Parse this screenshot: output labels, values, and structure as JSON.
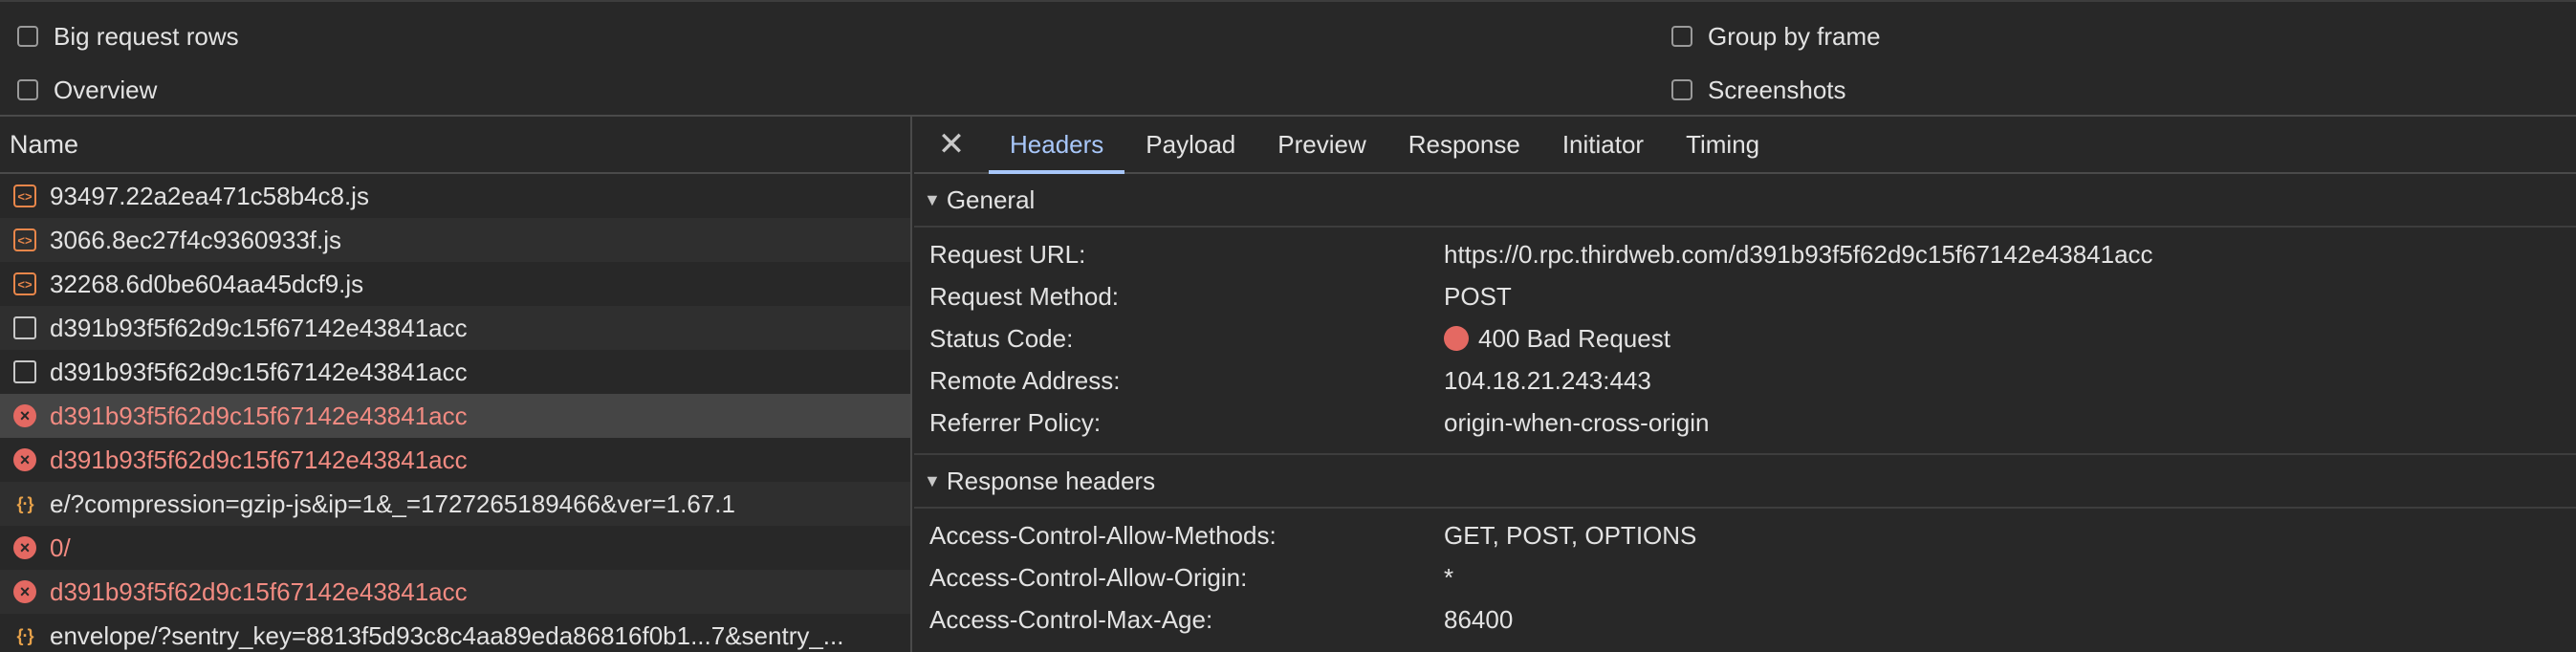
{
  "options": {
    "big_request_rows": "Big request rows",
    "overview": "Overview",
    "group_by_frame": "Group by frame",
    "screenshots": "Screenshots"
  },
  "list": {
    "header": "Name",
    "rows": [
      {
        "name": "93497.22a2ea471c58b4c8.js",
        "type": "script-icon"
      },
      {
        "name": "3066.8ec27f4c9360933f.js",
        "type": "script-icon"
      },
      {
        "name": "32268.6d0be604aa45dcf9.js",
        "type": "script-icon"
      },
      {
        "name": "d391b93f5f62d9c15f67142e43841acc",
        "type": "document-icon"
      },
      {
        "name": "d391b93f5f62d9c15f67142e43841acc",
        "type": "document-icon"
      },
      {
        "name": "d391b93f5f62d9c15f67142e43841acc",
        "type": "error-icon"
      },
      {
        "name": "d391b93f5f62d9c15f67142e43841acc",
        "type": "error-icon"
      },
      {
        "name": "e/?compression=gzip-js&ip=1&_=1727265189466&ver=1.67.1",
        "type": "xhr-icon"
      },
      {
        "name": "0/",
        "type": "error-icon"
      },
      {
        "name": "d391b93f5f62d9c15f67142e43841acc",
        "type": "error-icon"
      },
      {
        "name": "envelope/?sentry_key=8813f5d93c8c4aa89eda86816f0b1...7&sentry_...",
        "type": "xhr-icon"
      }
    ]
  },
  "tabs": [
    "Headers",
    "Payload",
    "Preview",
    "Response",
    "Initiator",
    "Timing"
  ],
  "general": {
    "title": "General",
    "items": [
      {
        "key": "Request URL:",
        "value": "https://0.rpc.thirdweb.com/d391b93f5f62d9c15f67142e43841acc"
      },
      {
        "key": "Request Method:",
        "value": "POST"
      },
      {
        "key": "Status Code:",
        "value": "400 Bad Request"
      },
      {
        "key": "Remote Address:",
        "value": "104.18.21.243:443"
      },
      {
        "key": "Referrer Policy:",
        "value": "origin-when-cross-origin"
      }
    ]
  },
  "response_headers": {
    "title": "Response headers",
    "items": [
      {
        "key": "Access-Control-Allow-Methods:",
        "value": "GET, POST, OPTIONS"
      },
      {
        "key": "Access-Control-Allow-Origin:",
        "value": "*"
      },
      {
        "key": "Access-Control-Max-Age:",
        "value": "86400"
      }
    ]
  },
  "colors": {
    "accent": "#a8c7fa",
    "error": "#e46962",
    "error_text": "#f28b82",
    "script": "#e8864a"
  }
}
